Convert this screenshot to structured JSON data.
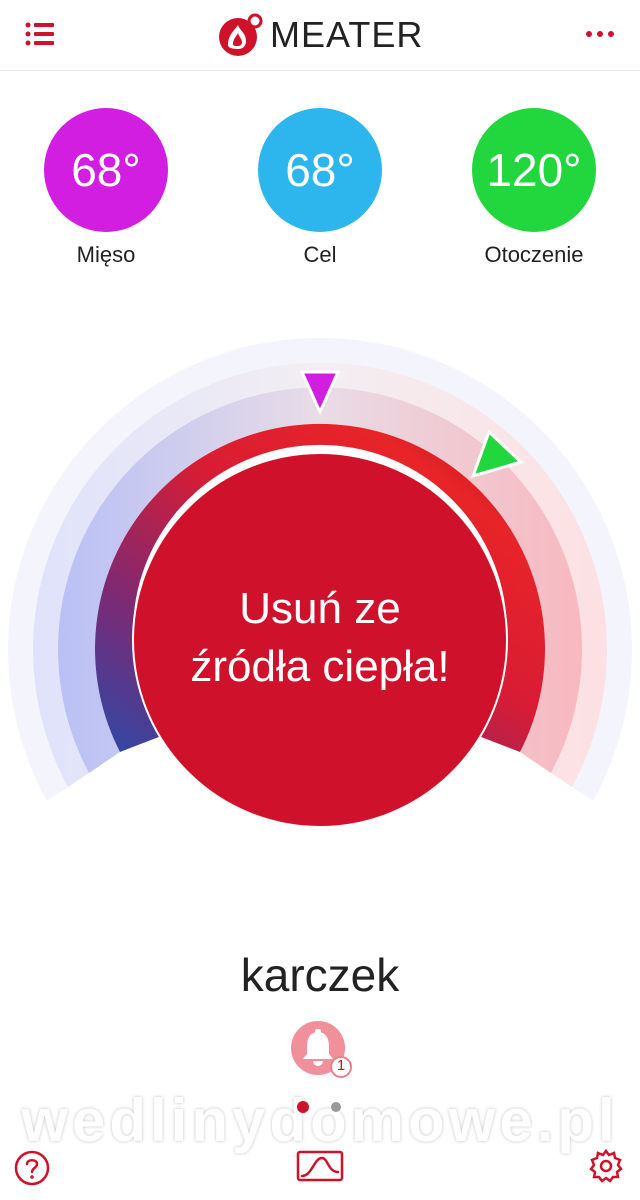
{
  "app": {
    "title": "MEATER"
  },
  "temps": [
    {
      "value": "68°",
      "label": "Mięso",
      "color": "#d21ee0"
    },
    {
      "value": "68°",
      "label": "Cel",
      "color": "#2db6ee"
    },
    {
      "value": "120°",
      "label": "Otoczenie",
      "color": "#22d63e"
    }
  ],
  "dial": {
    "message_line1": "Usuń ze",
    "message_line2": "źródła ciepła!"
  },
  "cook": {
    "name": "karczek"
  },
  "alarm": {
    "count": "1"
  },
  "pager": {
    "current": 1,
    "total": 2
  },
  "watermark": {
    "text": "wedlinydomowe.pl"
  },
  "colors": {
    "accent": "#d0112b",
    "meat_marker": "#d21ee0",
    "target_marker": "#22d63e"
  }
}
